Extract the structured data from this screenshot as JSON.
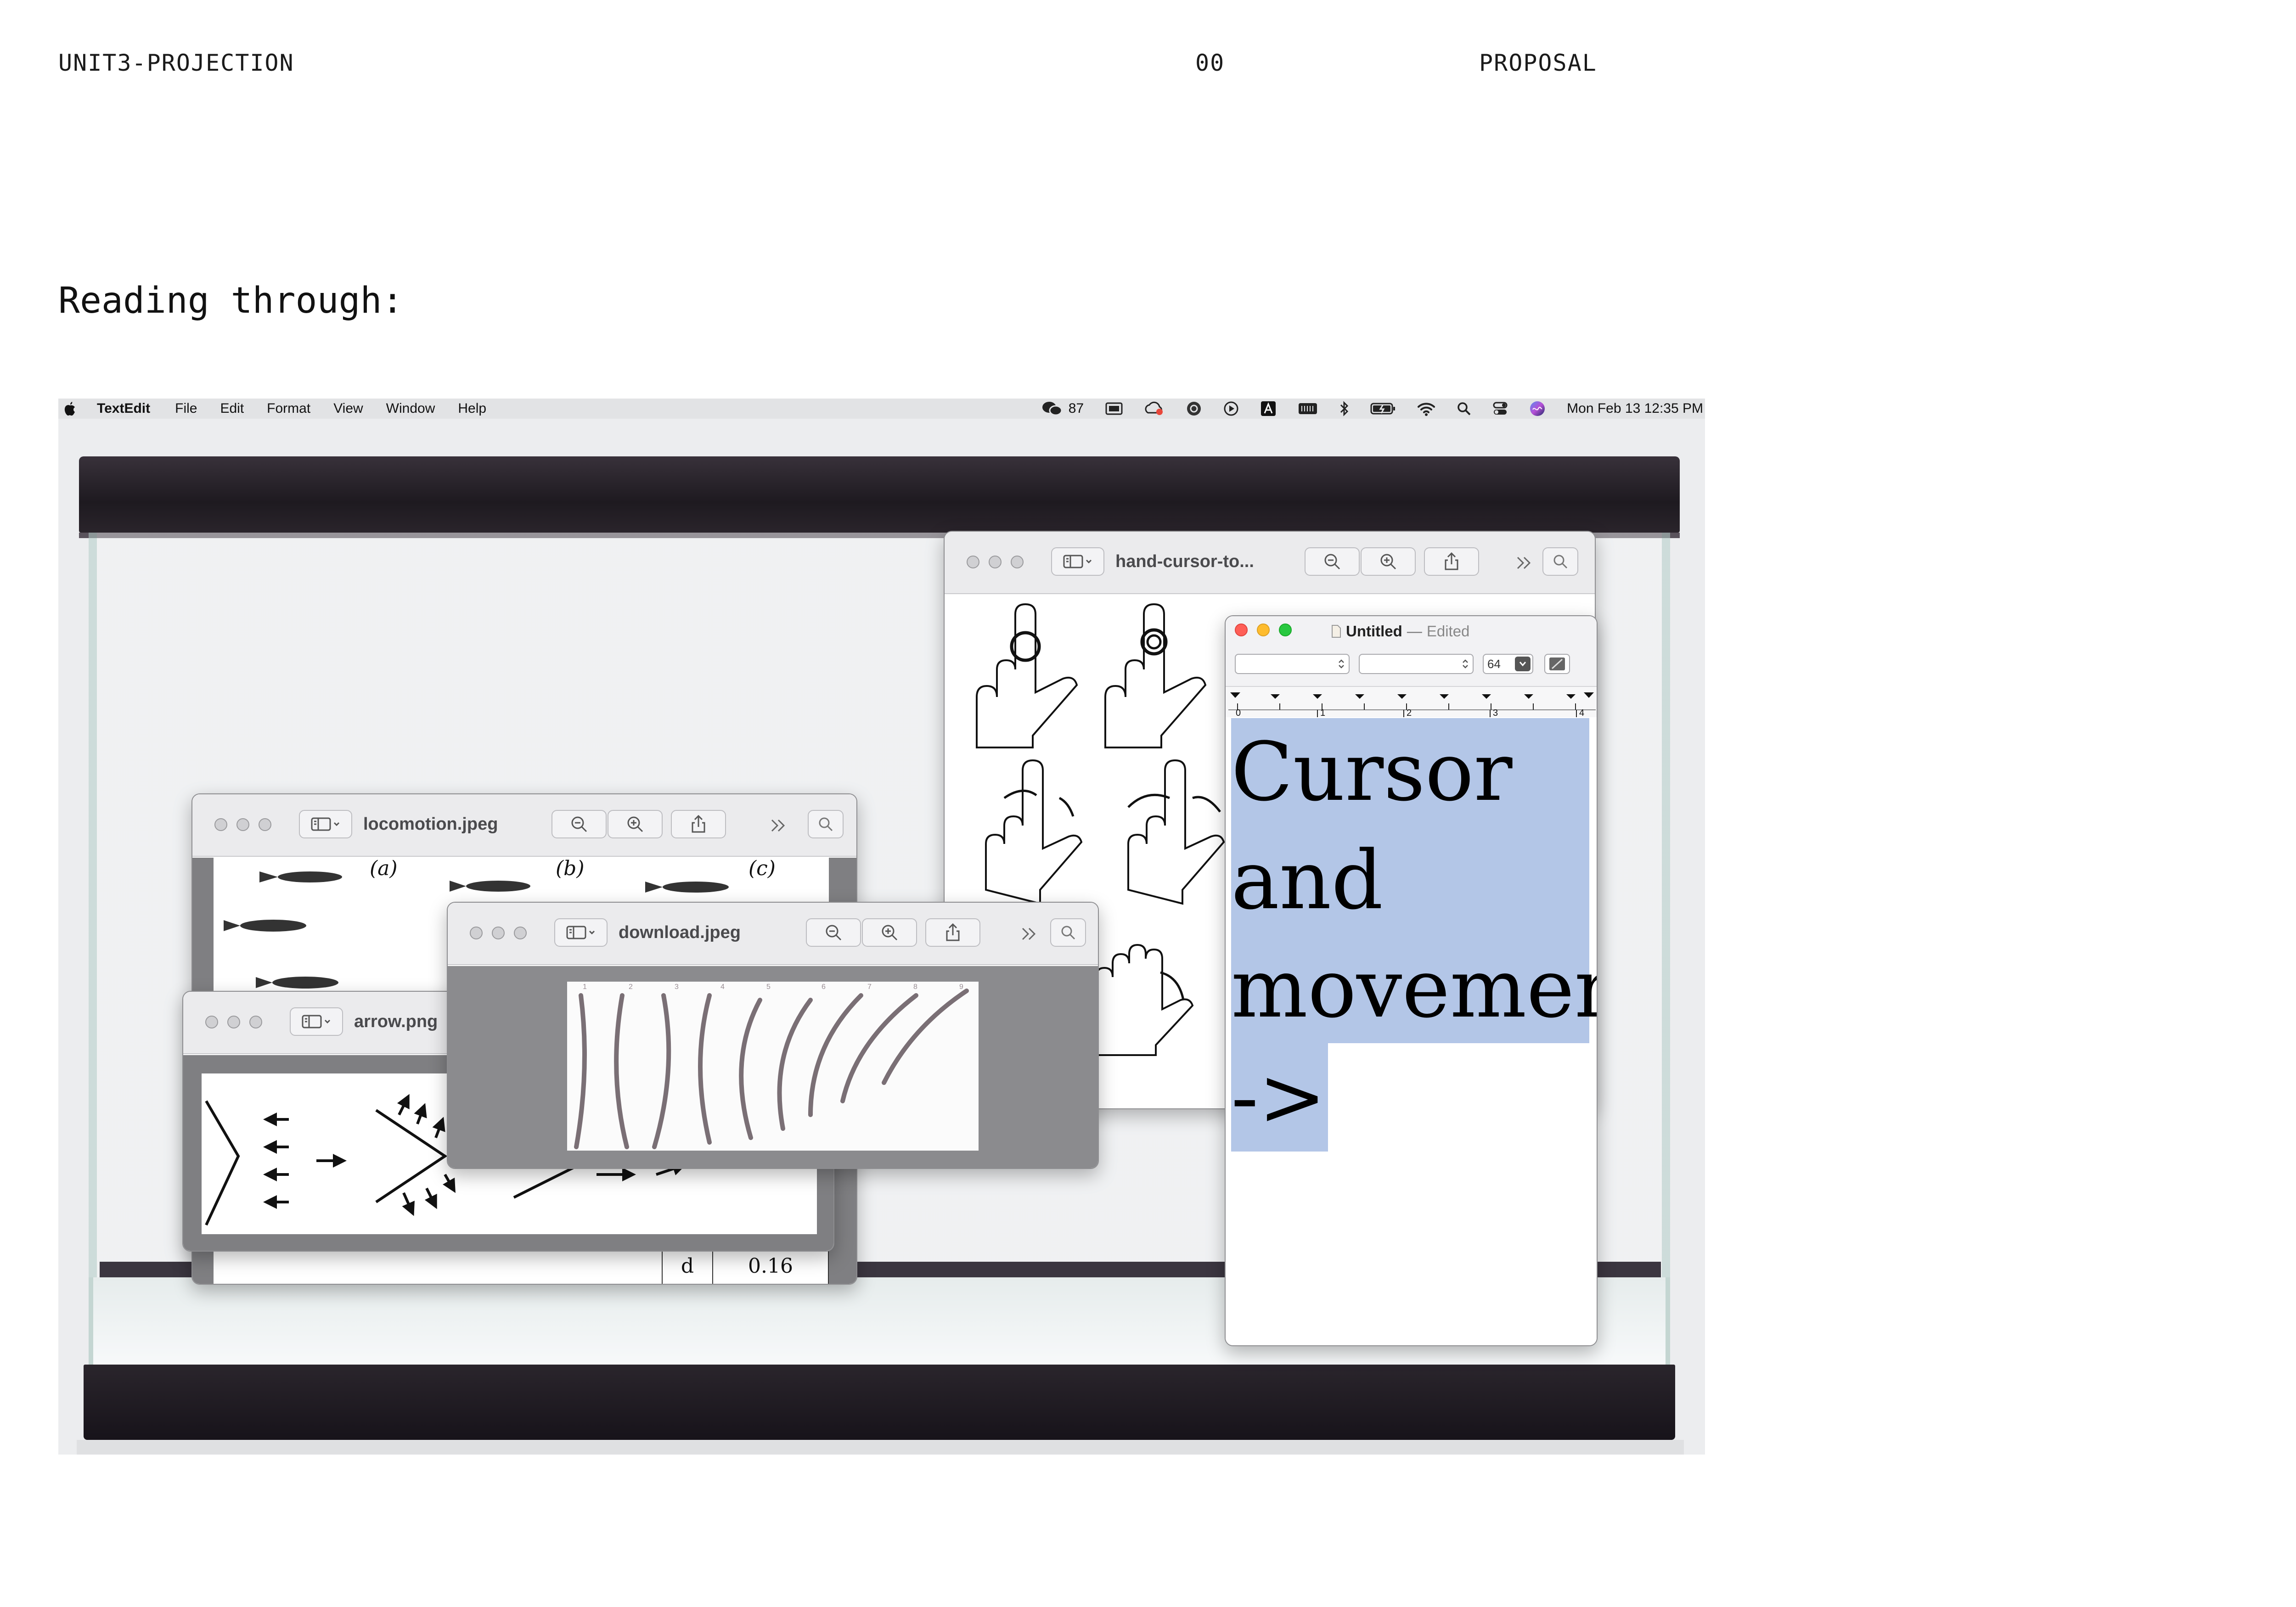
{
  "header": {
    "left": "UNIT3-PROJECTION",
    "center": "00",
    "right": "PROPOSAL"
  },
  "subtitle": "Reading through:",
  "menubar": {
    "app": "TextEdit",
    "items": [
      "File",
      "Edit",
      "Format",
      "View",
      "Window",
      "Help"
    ],
    "badge_count": "87",
    "datetime": "Mon Feb 13  12:35 PM"
  },
  "windows": {
    "hand_cursor": {
      "title": "hand-cursor-to..."
    },
    "locomotion": {
      "title": "locomotion.jpeg",
      "panel_labels": [
        "(a)",
        "(b)",
        "(c)"
      ],
      "table_cells": [
        "d",
        "0.16"
      ]
    },
    "download": {
      "title": "download.jpeg"
    },
    "arrow": {
      "title": "arrow.png"
    },
    "textedit": {
      "title": "Untitled",
      "separator": "—",
      "status": "Edited",
      "font_size": "64",
      "ruler_marks": [
        "0",
        "1",
        "2",
        "3",
        "4"
      ],
      "lines": [
        "Cursor",
        "and",
        "movement",
        "->"
      ]
    }
  },
  "colors": {
    "selection": "#b3c6e7",
    "tank_frame": "#231e25",
    "close": "#ff5f57",
    "minimize": "#febc2e",
    "zoom": "#28c840"
  },
  "icons": [
    "apple-icon",
    "wechat-icon",
    "wifi-icon",
    "bluetooth-icon",
    "battery-icon",
    "search-icon",
    "control-center-icon",
    "siri-icon",
    "zoom-out-icon",
    "zoom-in-icon",
    "share-icon",
    "sidebar-icon"
  ]
}
